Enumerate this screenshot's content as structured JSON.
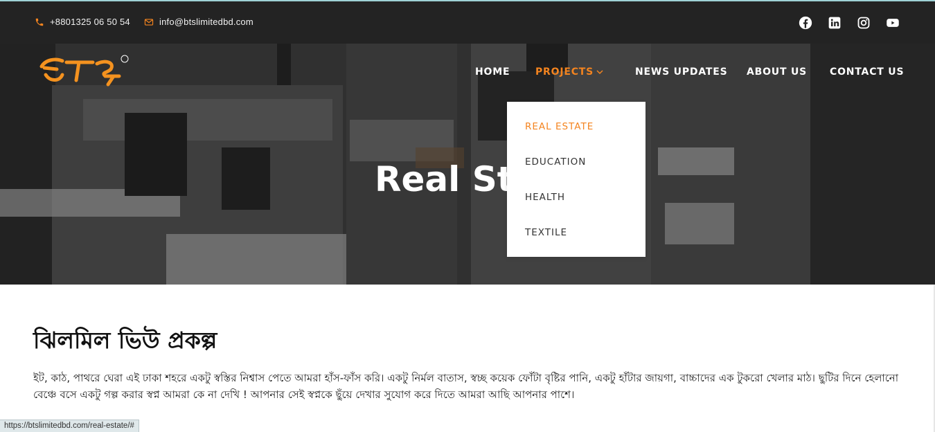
{
  "topbar": {
    "phone": "+8801325 06 50 54",
    "email": "info@btslimitedbd.com",
    "social_icons": [
      "facebook-icon",
      "linkedin-icon",
      "instagram-icon",
      "youtube-icon"
    ],
    "accent_color": "#f4841f"
  },
  "logo": {
    "text": "BTS"
  },
  "nav": {
    "items": [
      {
        "label": "HOME"
      },
      {
        "label": "PROJECTS",
        "active": true
      },
      {
        "label": "NEWS UPDATES"
      },
      {
        "label": "ABOUT US"
      },
      {
        "label": "CONTACT US"
      }
    ]
  },
  "dropdown": {
    "items": [
      {
        "label": "REAL ESTATE",
        "active": true
      },
      {
        "label": "EDUCATION"
      },
      {
        "label": "HEALTH"
      },
      {
        "label": "TEXTILE"
      }
    ]
  },
  "hero": {
    "title": "Real Sta"
  },
  "content": {
    "title": "ঝিলমিল ভিউ প্রকল্প",
    "body": "ইট, কাঠ, পাথরে ঘেরা এই ঢাকা শহরে একটু স্বস্তির নিশ্বাস পেতে আমরা হাঁস-ফাঁস করি। একটু নির্মল বাতাস, স্বচ্ছ কয়েক ফোঁটা বৃষ্টির পানি, একটু হাঁটার জায়গা, বাচ্চাদের এক টুকরো খেলার মাঠ। ছুটির দিনে হেলানো বেঞ্চে বসে একটু গল্প করার স্বপ্ন আমরা কে না দেখি ! আপনার সেই স্বপ্নকে ছুঁয়ে দেখার সুযোগ করে দিতে আমরা আছি আপনার পাশে।"
  },
  "statusbar": {
    "url": "https://btslimitedbd.com/real-estate/#"
  }
}
